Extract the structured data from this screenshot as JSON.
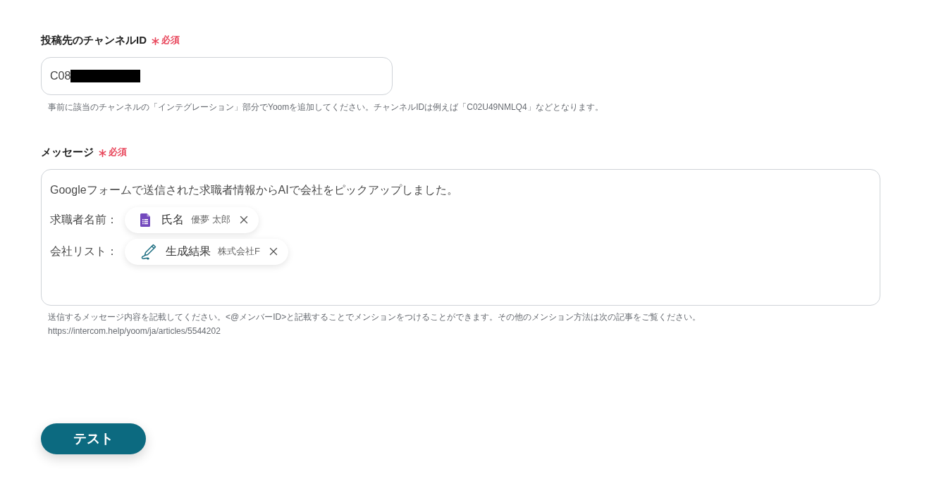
{
  "fields": [
    {
      "kind": "input",
      "label": "投稿先のチャンネルID",
      "required": true,
      "required_text": "必須",
      "value": "C08",
      "redacted": true,
      "help": [
        "事前に該当のチャンネルの「インテグレーション」部分でYoomを追加してください。チャンネルIDは例えば「C02U49NMLQ4」などとなります。"
      ]
    },
    {
      "kind": "message",
      "label": "メッセージ",
      "required": true,
      "required_text": "必須",
      "lines": [
        {
          "text": "Googleフォームで送信された求職者情報からAIで会社をピックアップしました。"
        },
        {
          "text": "求職者名前：",
          "chips": [
            {
              "kind": "form",
              "name": "氏名",
              "value": "優夢 太郎"
            }
          ]
        },
        {
          "text": "会社リスト：",
          "chips": [
            {
              "kind": "ai",
              "name": "生成結果",
              "value": "株式会社F"
            }
          ]
        }
      ],
      "help": [
        "送信するメッセージ内容を記載してください。<@メンバーID>と記載することでメンションをつけることができます。その他のメンション方法は次の記事をご覧ください。",
        "https://intercom.help/yoom/ja/articles/5544202"
      ]
    }
  ],
  "test_button": "テスト"
}
